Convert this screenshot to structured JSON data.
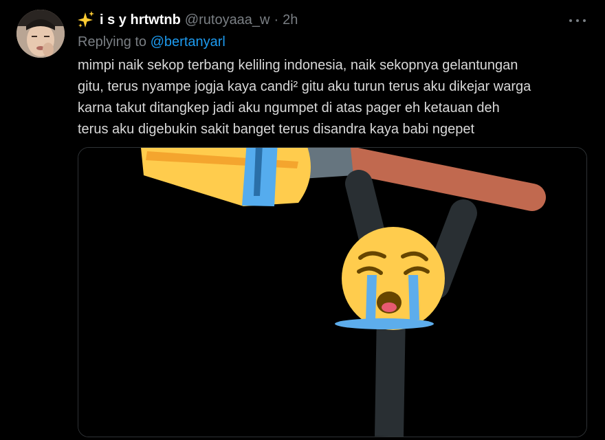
{
  "tweet": {
    "sparkle_icon": "sparkles-emoji",
    "display_name": "i s y hrtwtnb",
    "handle": "@rutoyaaa_w",
    "separator": "·",
    "time": "2h",
    "reply_prefix": "Replying to",
    "reply_to": "@bertanyarl",
    "text_lines": [
      "mimpi naik sekop terbang keliling indonesia, naik sekopnya gelantungan",
      "gitu, terus nyampe jogja kaya candi² gitu aku turun terus aku dikejar warga",
      "karna takut ditangkep jadi aku ngumpet di atas pager eh ketauan deh",
      "terus aku digebukin sakit banget terus disandra kaya babi ngepet"
    ],
    "media_icon": "crying-face-stick-figure-hanging-from-broom"
  },
  "colors": {
    "background": "#000000",
    "text": "#d9d9d9",
    "muted": "#7a7f84",
    "link": "#1d9bf0",
    "media_border": "#2f3336"
  }
}
